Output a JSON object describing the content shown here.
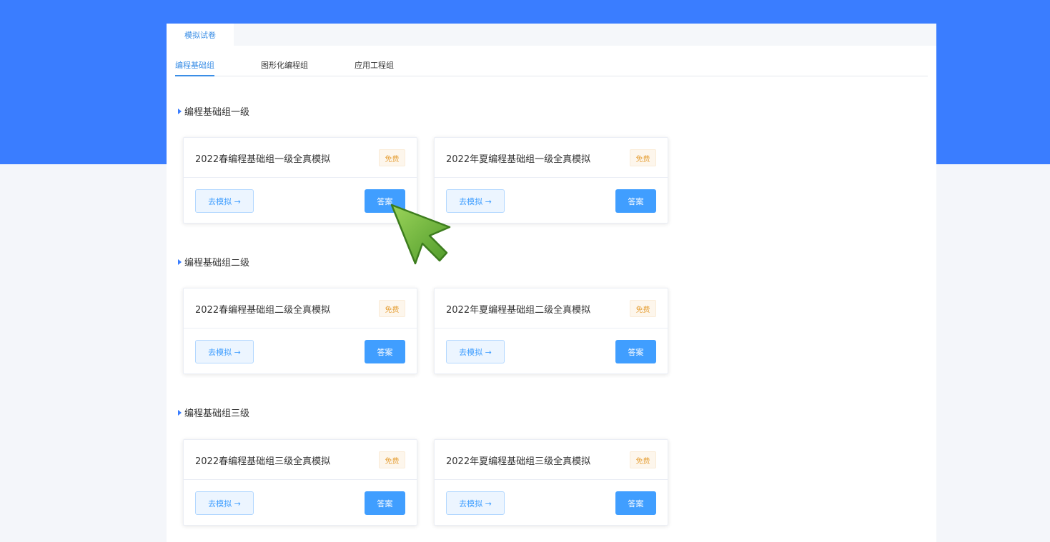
{
  "top_tab": {
    "label": "模拟试卷"
  },
  "sub_tabs": [
    {
      "label": "编程基础组"
    },
    {
      "label": "图形化编程组"
    },
    {
      "label": "应用工程组"
    }
  ],
  "sections": [
    {
      "title": "编程基础组一级",
      "cards": [
        {
          "title": "2022春编程基础组一级全真模拟",
          "badge": "免费",
          "simulate": "去模拟 →",
          "answer": "答案"
        },
        {
          "title": "2022年夏编程基础组一级全真模拟",
          "badge": "免费",
          "simulate": "去模拟 →",
          "answer": "答案"
        }
      ]
    },
    {
      "title": "编程基础组二级",
      "cards": [
        {
          "title": "2022春编程基础组二级全真模拟",
          "badge": "免费",
          "simulate": "去模拟 →",
          "answer": "答案"
        },
        {
          "title": "2022年夏编程基础组二级全真模拟",
          "badge": "免费",
          "simulate": "去模拟 →",
          "answer": "答案"
        }
      ]
    },
    {
      "title": "编程基础组三级",
      "cards": [
        {
          "title": "2022春编程基础组三级全真模拟",
          "badge": "免费",
          "simulate": "去模拟 →",
          "answer": "答案"
        },
        {
          "title": "2022年夏编程基础组三级全真模拟",
          "badge": "免费",
          "simulate": "去模拟 →",
          "answer": "答案"
        }
      ]
    }
  ],
  "colors": {
    "banner": "#3a7dff",
    "primary": "#409eff",
    "cursor": "#6db33f"
  },
  "icons": {
    "cursor": "pointer-arrow-icon",
    "section_marker": "triangle-right-icon"
  }
}
